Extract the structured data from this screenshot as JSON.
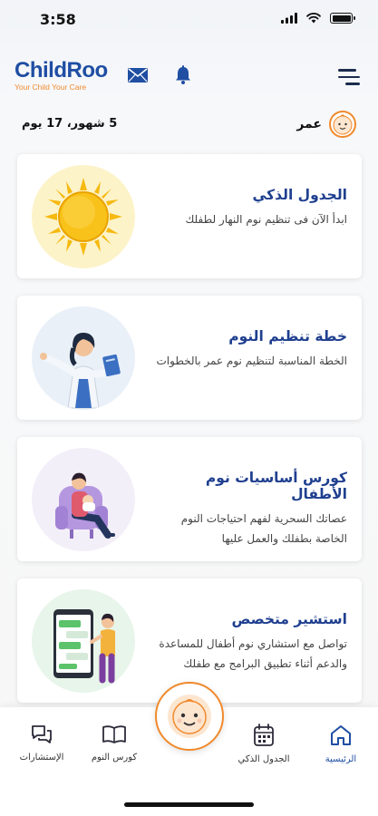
{
  "status_bar": {
    "time": "3:58"
  },
  "header": {
    "logo_title": "ChildRoo",
    "logo_tagline": "Your Child Your Care",
    "icons": [
      "mail-icon",
      "bell-icon",
      "menu-icon"
    ]
  },
  "child": {
    "name": "عمر",
    "age": "5 شهور، 17 يوم"
  },
  "cards": [
    {
      "title": "الجدول الذكي",
      "desc": "ابدأ الآن فى تنظيم نوم النهار لطفلك",
      "image": "sun-illustration"
    },
    {
      "title": "خطة تنظيم النوم",
      "desc": "الخطة المناسبة لتنظيم نوم عمر بالخطوات",
      "image": "doctor-illustration"
    },
    {
      "title": "كورس أساسيات نوم الأطفال",
      "desc": "عصاتك السحرية لفهم احتياجات النوم الخاصة بطفلك والعمل عليها",
      "image": "mother-illustration"
    },
    {
      "title": "استشير متخصص",
      "desc": "تواصل مع استشاري نوم أطفال للمساعدة والدعم أثناء تطبيق البرامج مع طفلك",
      "image": "phone-illustration"
    }
  ],
  "nav": {
    "home": "الرئيسية",
    "schedule": "الجدول الذكي",
    "course": "كورس النوم",
    "consult": "الإستشارات"
  },
  "colors": {
    "brand_blue": "#1f4ea3",
    "accent_orange": "#f08a2c"
  }
}
